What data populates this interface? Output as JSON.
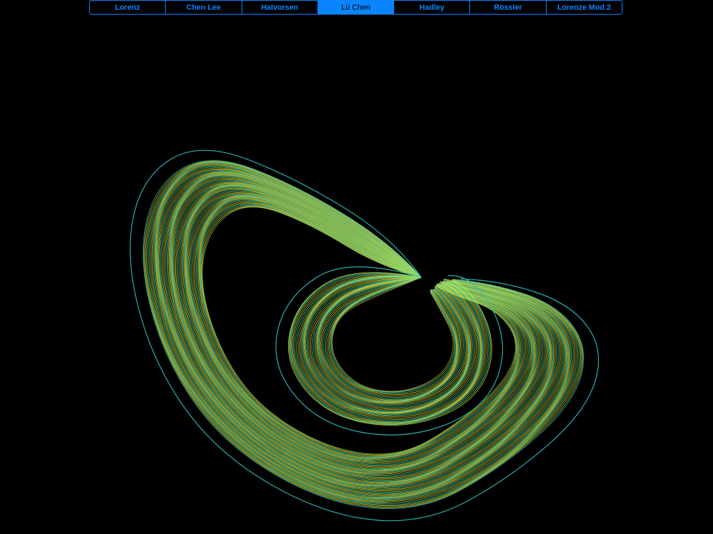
{
  "segmented_control": {
    "selected_index": 3,
    "items": [
      {
        "label": "Lorenz"
      },
      {
        "label": "Chen Lee"
      },
      {
        "label": "Halvorsen"
      },
      {
        "label": "Lü Chen"
      },
      {
        "label": "Hadley"
      },
      {
        "label": "Rössler"
      },
      {
        "label": "Lorenze Mod 2"
      }
    ]
  },
  "colors": {
    "background": "#000000",
    "accent": "#0a84ff",
    "trajectory_green": "#7ee36a",
    "trajectory_yellow": "#e6f23c",
    "trajectory_orange": "#e0a828",
    "trajectory_cyan": "#2ec4c4"
  }
}
